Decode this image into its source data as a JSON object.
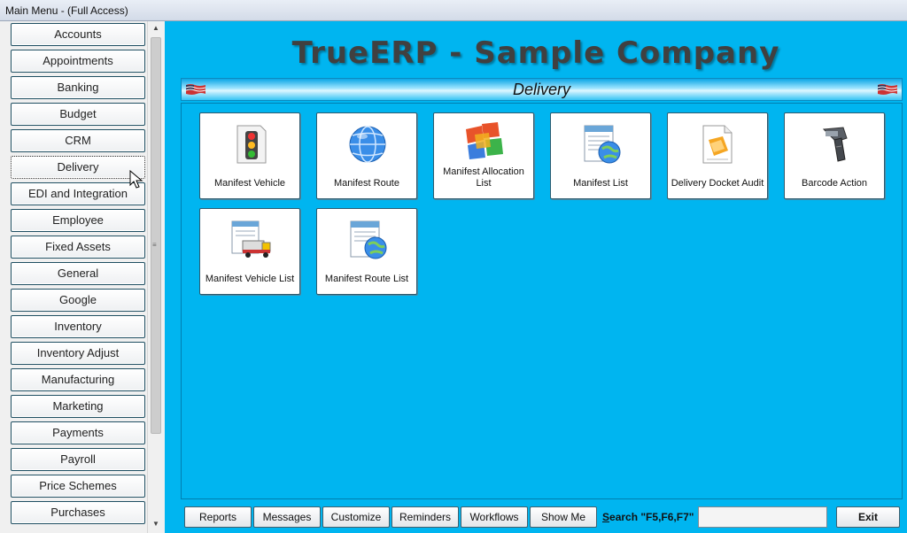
{
  "window": {
    "title": "Main Menu - (Full Access)"
  },
  "sidebar": {
    "items": [
      {
        "label": "Accounts"
      },
      {
        "label": "Appointments"
      },
      {
        "label": "Banking"
      },
      {
        "label": "Budget"
      },
      {
        "label": "CRM"
      },
      {
        "label": "Delivery",
        "active": true
      },
      {
        "label": "EDI and Integration"
      },
      {
        "label": "Employee"
      },
      {
        "label": "Fixed Assets"
      },
      {
        "label": "General"
      },
      {
        "label": "Google"
      },
      {
        "label": "Inventory"
      },
      {
        "label": "Inventory Adjust"
      },
      {
        "label": "Manufacturing"
      },
      {
        "label": "Marketing"
      },
      {
        "label": "Payments"
      },
      {
        "label": "Payroll"
      },
      {
        "label": "Price Schemes"
      },
      {
        "label": "Purchases"
      }
    ]
  },
  "header": {
    "company_title": "TrueERP - Sample Company",
    "section_title": "Delivery"
  },
  "tiles": [
    {
      "label": "Manifest Vehicle",
      "icon": "traffic-light-icon"
    },
    {
      "label": "Manifest Route",
      "icon": "globe-icon"
    },
    {
      "label": "Manifest Allocation List",
      "icon": "colored-blocks-icon"
    },
    {
      "label": "Manifest List",
      "icon": "list-globe-icon"
    },
    {
      "label": "Delivery Docket Audit",
      "icon": "document-audit-icon"
    },
    {
      "label": "Barcode Action",
      "icon": "barcode-scanner-icon"
    },
    {
      "label": "Manifest Vehicle List",
      "icon": "list-truck-icon"
    },
    {
      "label": "Manifest Route List",
      "icon": "list-globe-icon"
    }
  ],
  "bottom": {
    "reports": "Reports",
    "messages": "Messages",
    "customize": "Customize",
    "reminders": "Reminders",
    "workflows": "Workflows",
    "show_me": "Show Me",
    "search_label_s": "S",
    "search_label_rest": "earch \"F5,F6,F7\"",
    "search_value": "",
    "exit": "Exit"
  },
  "colors": {
    "main_bg": "#00b5f0",
    "company_title": "#404040",
    "tile_border": "#2d5b6f"
  }
}
